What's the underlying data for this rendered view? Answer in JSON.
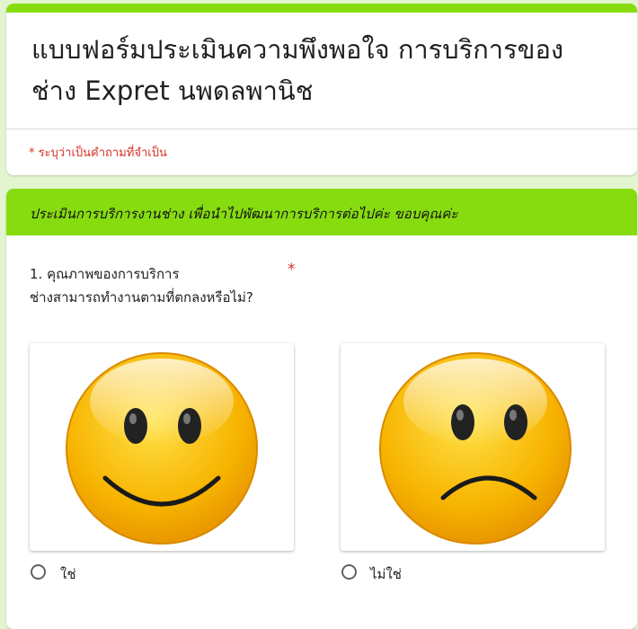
{
  "form": {
    "title": "แบบฟอร์มประเมินความพึงพอใจ การบริการของช่าง Expret นพดลพานิช",
    "required_note": "* ระบุว่าเป็นคำถามที่จำเป็น",
    "accent_color": "#87dc10",
    "background_color": "#e3f5cf"
  },
  "section": {
    "description": "ประเมินการบริการงานช่าง เพื่อนำไปพัฒนาการบริการต่อไปค่ะ ขอบคุณค่ะ"
  },
  "question": {
    "title_line1": "1. คุณภาพของการบริการ",
    "title_line2": "ช่างสามารถทำงานตามที่ตกลงหรือไม่?",
    "required_mark": "*",
    "options": [
      {
        "label": "ใช่",
        "image": "smiling-face-icon",
        "selected": false
      },
      {
        "label": "ไม่ใช่",
        "image": "frowning-face-icon",
        "selected": false
      }
    ]
  }
}
